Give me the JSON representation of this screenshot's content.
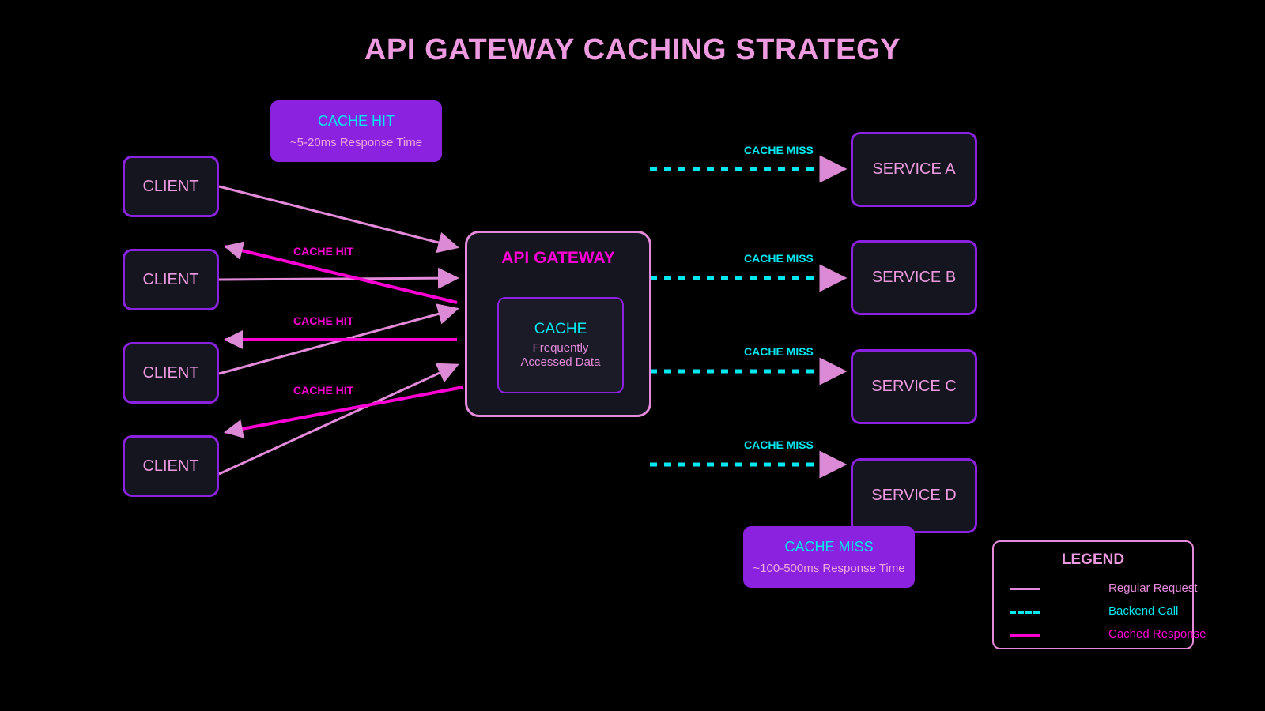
{
  "page": {
    "title": "API GATEWAY CACHING STRATEGY",
    "background": "#000000"
  },
  "colors": {
    "title": "#ee9ae0",
    "node_border": "#8b22e0",
    "node_fill": "#15151f",
    "node_text": "#ee9ae0",
    "gateway_border": "#e48ada",
    "gateway_title": "#ff00d4",
    "cache_title": "#00e8f0",
    "callout_fill": "#8b22e0",
    "regular_request": "#e48ada",
    "backend_call": "#00e8f0",
    "cached_response": "#ff00d4"
  },
  "gateway": {
    "title": "API GATEWAY",
    "cache": {
      "title": "CACHE",
      "line1": "Frequently",
      "line2": "Accessed Data"
    }
  },
  "clients": [
    {
      "label": "CLIENT"
    },
    {
      "label": "CLIENT"
    },
    {
      "label": "CLIENT"
    },
    {
      "label": "CLIENT"
    }
  ],
  "services": [
    {
      "label": "SERVICE A"
    },
    {
      "label": "SERVICE B"
    },
    {
      "label": "SERVICE C"
    },
    {
      "label": "SERVICE D"
    }
  ],
  "callouts": {
    "hit": {
      "title": "CACHE HIT",
      "subtitle": "~5-20ms Response Time"
    },
    "miss": {
      "title": "CACHE MISS",
      "subtitle": "~100-500ms Response Time"
    }
  },
  "edge_labels": {
    "cache_hit": "CACHE HIT",
    "cache_miss": "CACHE MISS"
  },
  "legend": {
    "title": "LEGEND",
    "items": [
      {
        "label": "Regular Request",
        "style": "solid",
        "color": "#e48ada"
      },
      {
        "label": "Backend Call",
        "style": "dashed",
        "color": "#00e8f0"
      },
      {
        "label": "Cached Response",
        "style": "solid",
        "color": "#ff00d4"
      }
    ]
  }
}
